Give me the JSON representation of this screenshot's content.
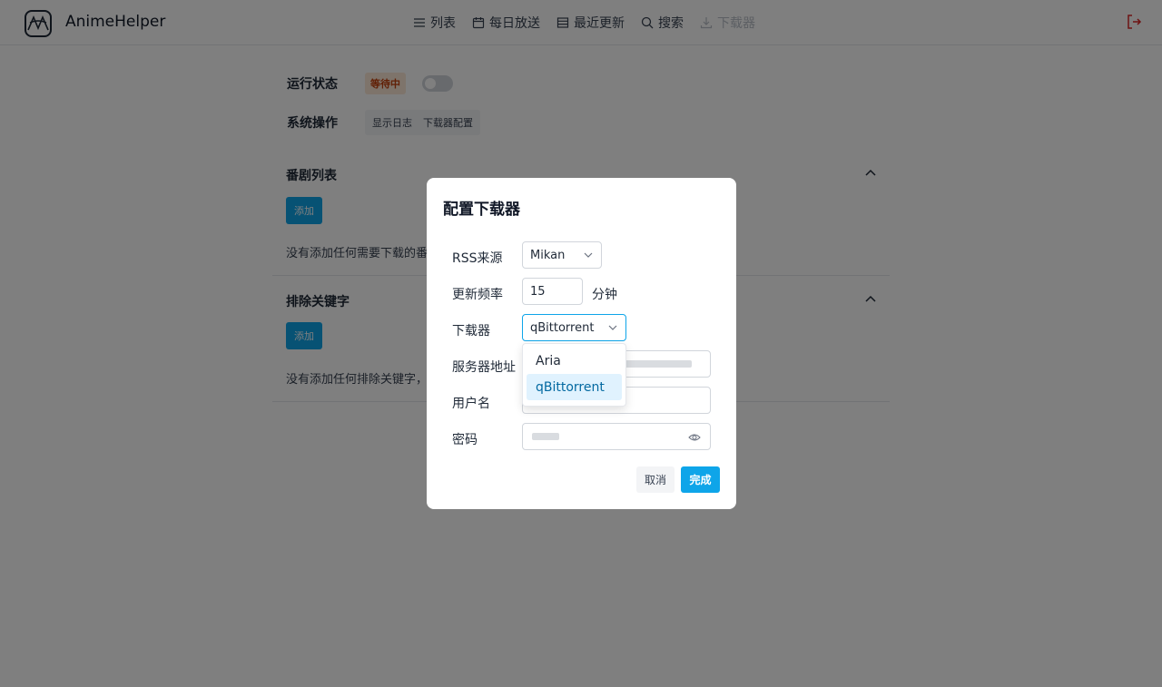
{
  "header": {
    "app_title": "AnimeHelper",
    "nav": [
      {
        "label": "列表",
        "icon": "list-icon",
        "disabled": false
      },
      {
        "label": "每日放送",
        "icon": "calendar-icon",
        "disabled": false
      },
      {
        "label": "最近更新",
        "icon": "table-icon",
        "disabled": false
      },
      {
        "label": "搜索",
        "icon": "search-icon",
        "disabled": false
      },
      {
        "label": "下载器",
        "icon": "download-icon",
        "disabled": true
      }
    ],
    "logout_icon": "logout-icon"
  },
  "main": {
    "status_label": "运行状态",
    "status_badge": "等待中",
    "system_ops_label": "系统操作",
    "show_log": "显示日志",
    "downloader_config": "下载器配置",
    "anime_list_title": "番剧列表",
    "anime_add": "添加",
    "anime_empty": "没有添加任何需要下载的番剧",
    "exclude_title": "排除关键字",
    "exclude_add": "添加",
    "exclude_empty": "没有添加任何排除关键字，"
  },
  "modal": {
    "title": "配置下载器",
    "rss_label": "RSS来源",
    "rss_value": "Mikan",
    "freq_label": "更新频率",
    "freq_value": "15",
    "freq_unit": "分钟",
    "downloader_label": "下载器",
    "downloader_value": "qBittorrent",
    "server_label": "服务器地址",
    "user_label": "用户名",
    "password_label": "密码",
    "cancel": "取消",
    "done": "完成"
  },
  "dropdown": {
    "options": [
      "Aria",
      "qBittorrent"
    ],
    "selected": "qBittorrent"
  },
  "colors": {
    "primary": "#0ea5e9",
    "badge_bg": "#fde9d6",
    "badge_text": "#c2410c",
    "logout": "#dc2626"
  }
}
